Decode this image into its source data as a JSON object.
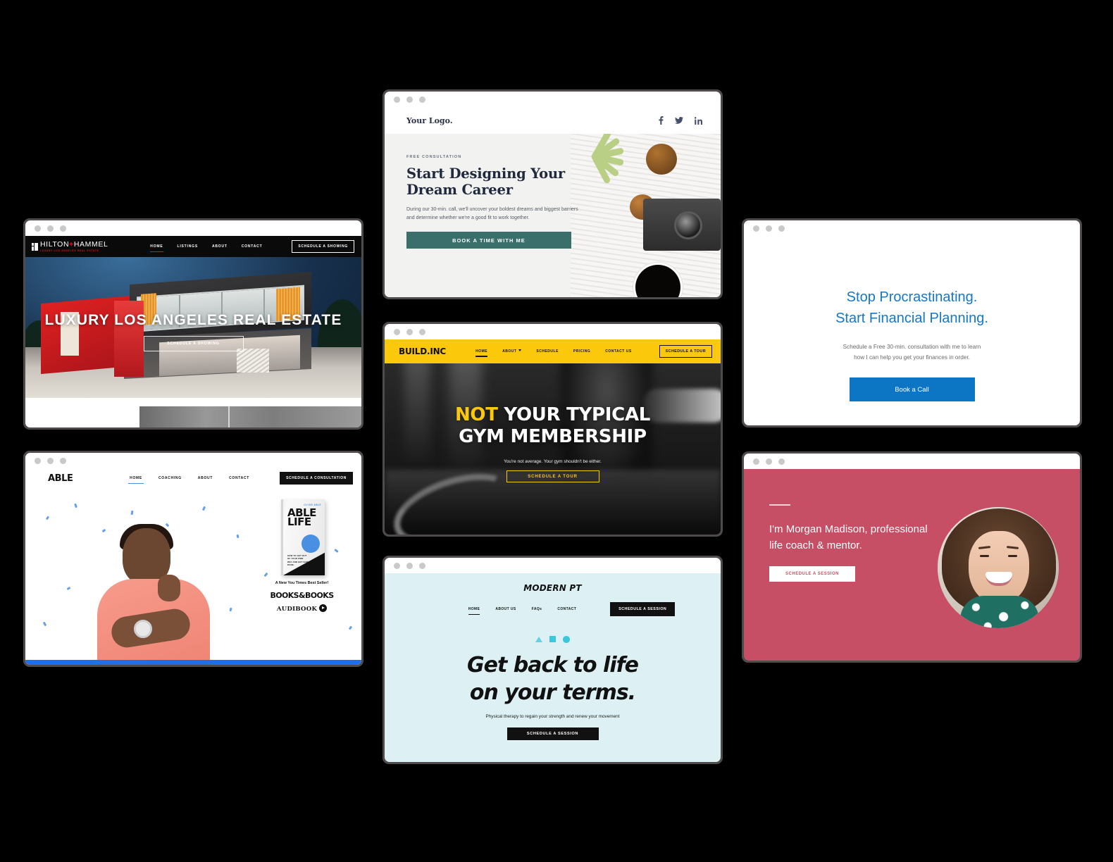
{
  "page": {
    "background_color": "#000000",
    "card_count": 7
  },
  "browser_chrome": {
    "dots": [
      "dot-red",
      "dot-yellow",
      "dot-green"
    ],
    "dot_color": "#c9c9c9",
    "frame_color": "#4f4b4a"
  },
  "hilton": {
    "logo_name": "HILTON",
    "logo_plus": "+",
    "logo_name2": "HAMMEL",
    "logo_tagline": "LUXURY LOS ANGELES REAL ESTATE",
    "nav": [
      {
        "label": "HOME",
        "active": true
      },
      {
        "label": "LISTINGS",
        "active": false
      },
      {
        "label": "ABOUT",
        "active": false
      },
      {
        "label": "CONTACT",
        "active": false
      }
    ],
    "cta": "SCHEDULE A SHOWING",
    "hero_title": "LUXURY LOS ANGELES REAL ESTATE",
    "hero_button": "SCHEDULE A SHOWING",
    "accent_color": "#d41b1b",
    "nav_background": "#0a0a0a"
  },
  "able": {
    "logo": "ABLE",
    "nav": [
      {
        "label": "HOME",
        "active": true
      },
      {
        "label": "COACHING",
        "active": false
      },
      {
        "label": "ABOUT",
        "active": false
      },
      {
        "label": "CONTACT",
        "active": false
      }
    ],
    "cta": "SCHEDULE A CONSULTATION",
    "book": {
      "author": "CLYDE ABLE",
      "title_line1": "ABLE",
      "title_line2": "LIFE",
      "subtitle": "HOW TO GET OUT OF YOUR OWN WAY AND GET SHIT DONE."
    },
    "seller_note": "A New You Times Best Seller!",
    "retailer": "BOOKS&BOOKS",
    "audiobook": "AUDIBOOK",
    "accent_color": "#1e6fe8"
  },
  "career": {
    "logo": "Your Logo.",
    "social": [
      "facebook-icon",
      "twitter-icon",
      "linkedin-icon"
    ],
    "eyebrow": "FREE CONSULTATION",
    "heading_line1": "Start Designing Your",
    "heading_line2": "Dream Career",
    "paragraph": "During our 30-min. call, we'll uncover your boldest dreams and biggest barriers and determine whether we're a good fit to work together.",
    "cta": "BOOK A TIME WITH ME",
    "cta_color": "#3b6f6c",
    "heading_color": "#20293d"
  },
  "build": {
    "logo": "BUILD.INC",
    "nav": [
      {
        "label": "HOME",
        "active": true,
        "caret": false
      },
      {
        "label": "ABOUT",
        "active": false,
        "caret": true
      },
      {
        "label": "SCHEDULE",
        "active": false,
        "caret": false
      },
      {
        "label": "PRICING",
        "active": false,
        "caret": false
      },
      {
        "label": "CONTACT US",
        "active": false,
        "caret": false
      }
    ],
    "cta": "SCHEDULE A TOUR",
    "hero_highlight": "NOT",
    "hero_line1_rest": " YOUR TYPICAL",
    "hero_line2": "GYM MEMBERSHIP",
    "hero_sub": "You're not average. Your gym shouldn't be either.",
    "hero_button": "SCHEDULE A TOUR",
    "brand_color": "#fcc80b"
  },
  "pt": {
    "logo": "MODERN PT",
    "nav": [
      {
        "label": "HOME",
        "active": true
      },
      {
        "label": "ABOUT US",
        "active": false
      },
      {
        "label": "FAQs",
        "active": false
      },
      {
        "label": "CONTACT",
        "active": false
      }
    ],
    "cta": "SCHEDULE A SESSION",
    "shapes": [
      "triangle-shape",
      "square-shape",
      "circle-shape"
    ],
    "heading_line1": "Get back to life",
    "heading_line2": "on your terms.",
    "paragraph": "Physical therapy to regain your strength and renew your movement",
    "button": "SCHEDULE A SESSION",
    "background_color": "#ddf1f4",
    "accent_color": "#3dc7dd"
  },
  "financial": {
    "heading_line1": "Stop Procrastinating.",
    "heading_line2": "Start Financial Planning.",
    "paragraph_line1": "Schedule a Free 30-min. consultation with me to learn",
    "paragraph_line2": "how I can help you get your finances in order.",
    "button": "Book a Call",
    "heading_color": "#1577c7",
    "button_color": "#0c76c4"
  },
  "morgan": {
    "heading": "I'm Morgan Madison, professional life coach & mentor.",
    "button": "SCHEDULE A SESSION",
    "background_color": "#c64f65",
    "photo_alt": "portrait-photo"
  }
}
